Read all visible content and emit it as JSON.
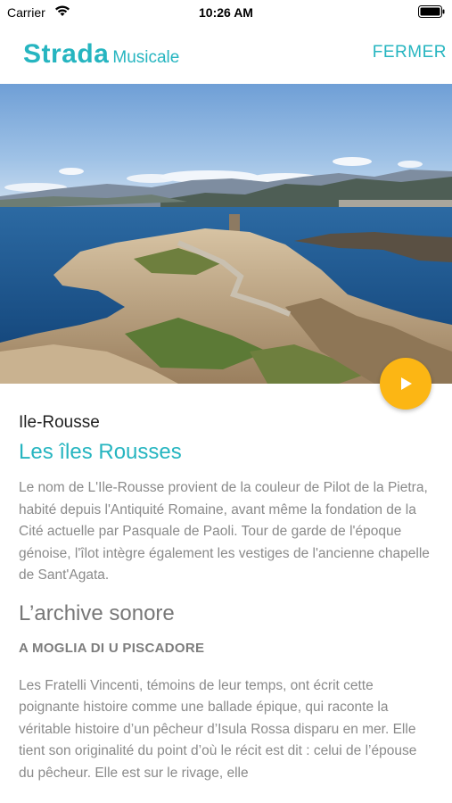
{
  "status_bar": {
    "carrier": "Carrier",
    "time": "10:26 AM"
  },
  "header": {
    "brand_main": "Strada",
    "brand_sub": "Musicale",
    "close_label": "FERMER"
  },
  "hero": {
    "image_icon": "coastal-landscape-image",
    "play_icon": "play-icon"
  },
  "content": {
    "location": "Ile-Rousse",
    "title": "Les îles Rousses",
    "description": "Le nom de L'Ile-Rousse provient de la couleur de Pilot de la Pietra, habité depuis l'Antiquité Romaine, avant même la fondation de la Cité actuelle par Pasquale de Paoli. Tour de garde de l'époque génoise, l'îlot intègre également les vestiges de l'ancienne chapelle de Sant'Agata.",
    "section_title": "L’archive sonore",
    "track_title": "A MOGLIA DI U PISCADORE",
    "track_description": "Les Fratelli Vincenti, témoins de leur temps, ont écrit cette poignante histoire comme une ballade épique, qui raconte la véritable histoire d’un pêcheur d’Isula Rossa disparu en mer. Elle tient son originalité du point d’où le récit est dit : celui de l’épouse du pêcheur. Elle est sur le rivage, elle"
  },
  "colors": {
    "accent": "#26b5c0",
    "play_button": "#fcb614"
  }
}
